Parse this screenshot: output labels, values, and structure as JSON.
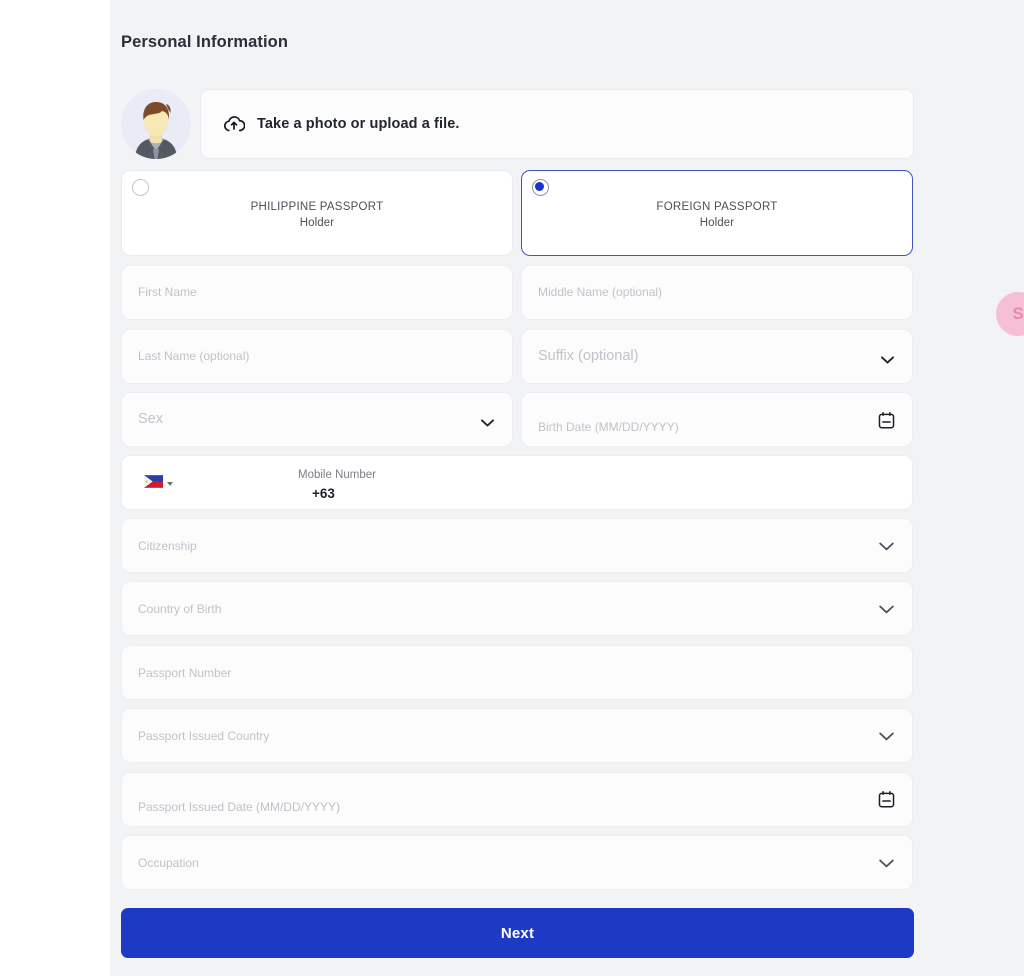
{
  "page": {
    "title": "Personal Information",
    "accent_color": "#1e3ac4",
    "background_color": "#f2f3f5"
  },
  "avatar": {
    "icon": "user-avatar-placeholder"
  },
  "upload": {
    "icon": "cloud-upload-icon",
    "label": "Take a photo or upload a file."
  },
  "passport_type": {
    "options": [
      {
        "title": "PHILIPPINE PASSPORT",
        "subtitle": "Holder",
        "selected": false
      },
      {
        "title": "FOREIGN PASSPORT",
        "subtitle": "Holder",
        "selected": true
      }
    ]
  },
  "fields": {
    "first_name": {
      "placeholder": "First Name"
    },
    "middle_name": {
      "placeholder": "Middle Name (optional)"
    },
    "last_name": {
      "placeholder": "Last Name (optional)"
    },
    "suffix": {
      "placeholder": "Suffix (optional)",
      "icon": "chevron-down-icon"
    },
    "sex": {
      "placeholder": "Sex",
      "icon": "chevron-down-icon"
    },
    "birth_date": {
      "placeholder": "Birth Date (MM/DD/YYYY)",
      "icon": "calendar-icon"
    },
    "mobile": {
      "flag": "philippines-flag-icon",
      "label": "Mobile Number",
      "country_code": "+63",
      "caret": "caret-down-icon"
    },
    "citizenship": {
      "placeholder": "Citizenship",
      "icon": "chevron-down-icon"
    },
    "country_of_birth": {
      "placeholder": "Country of Birth",
      "icon": "chevron-down-icon"
    },
    "passport_number": {
      "placeholder": "Passport Number"
    },
    "passport_issued_country": {
      "placeholder": "Passport Issued Country",
      "icon": "chevron-down-icon"
    },
    "passport_issued_date": {
      "placeholder": "Passport Issued Date (MM/DD/YYYY)",
      "icon": "calendar-icon"
    },
    "occupation": {
      "placeholder": "Occupation",
      "icon": "chevron-down-icon"
    }
  },
  "actions": {
    "next_label": "Next"
  },
  "widget": {
    "chat_label": "S"
  }
}
